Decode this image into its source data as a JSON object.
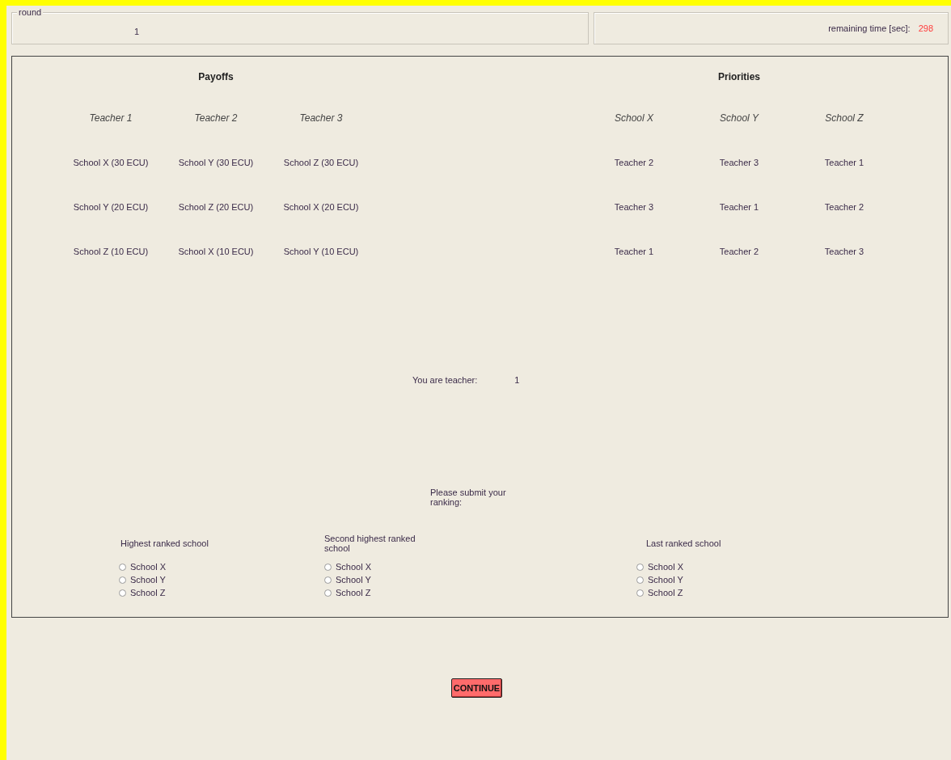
{
  "round": {
    "legend": "round",
    "value": "1"
  },
  "timer": {
    "label": "remaining time [sec]:",
    "value": "298"
  },
  "payoffs": {
    "title": "Payoffs",
    "columns": [
      {
        "header": "Teacher 1",
        "cells": [
          "School X (30 ECU)",
          "School Y (20 ECU)",
          "School Z (10 ECU)"
        ]
      },
      {
        "header": "Teacher 2",
        "cells": [
          "School Y (30 ECU)",
          "School Z (20 ECU)",
          "School X (10 ECU)"
        ]
      },
      {
        "header": "Teacher 3",
        "cells": [
          "School Z (30 ECU)",
          "School X (20 ECU)",
          "School Y (10 ECU)"
        ]
      }
    ]
  },
  "priorities": {
    "title": "Priorities",
    "columns": [
      {
        "header": "School X",
        "cells": [
          "Teacher 2",
          "Teacher 3",
          "Teacher 1"
        ]
      },
      {
        "header": "School Y",
        "cells": [
          "Teacher 3",
          "Teacher 1",
          "Teacher 2"
        ]
      },
      {
        "header": "School Z",
        "cells": [
          "Teacher 1",
          "Teacher 2",
          "Teacher 3"
        ]
      }
    ]
  },
  "identity": {
    "label": "You are teacher:",
    "value": "1"
  },
  "prompt": "Please submit your ranking:",
  "rankings": [
    {
      "label": "Highest ranked school",
      "options": [
        {
          "label": "School X",
          "selected": false
        },
        {
          "label": "School Y",
          "selected": false
        },
        {
          "label": "School Z",
          "selected": false
        }
      ]
    },
    {
      "label": "Second highest ranked school",
      "options": [
        {
          "label": "School X",
          "selected": false
        },
        {
          "label": "School Y",
          "selected": false
        },
        {
          "label": "School Z",
          "selected": false
        }
      ]
    },
    {
      "label": "Last ranked school",
      "options": [
        {
          "label": "School X",
          "selected": false
        },
        {
          "label": "School Y",
          "selected": false
        },
        {
          "label": "School Z",
          "selected": false
        }
      ]
    }
  ],
  "continue_button": "CONTINUE"
}
